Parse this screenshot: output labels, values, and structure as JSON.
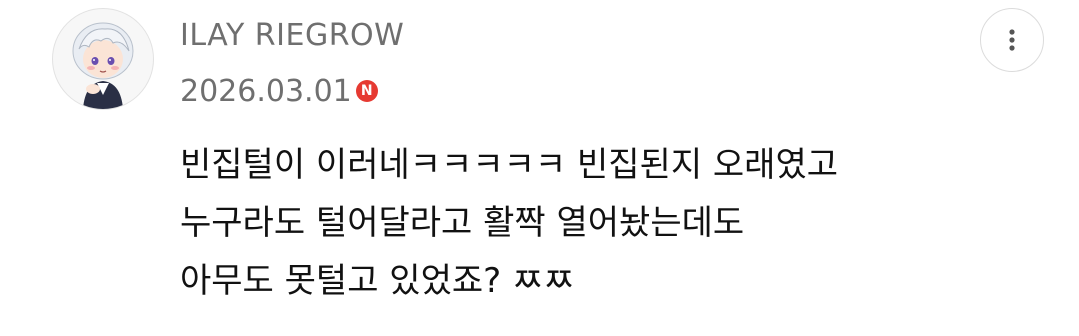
{
  "comment": {
    "author": "ILAY RIEGROW",
    "date": "2026.03.01",
    "new_badge": "N",
    "more_icon": "more-vertical-icon",
    "lines": [
      "빈집털이 이러네ㅋㅋㅋㅋㅋ 빈집된지 오래였고",
      "누구라도 털어달라고 활짝 열어놨는데도",
      "아무도 못털고 있었죠? ㅉㅉ"
    ]
  },
  "colors": {
    "name_text": "#6f6f6f",
    "body_text": "#111111",
    "badge": "#e63a32",
    "border": "#dcdcdc"
  }
}
